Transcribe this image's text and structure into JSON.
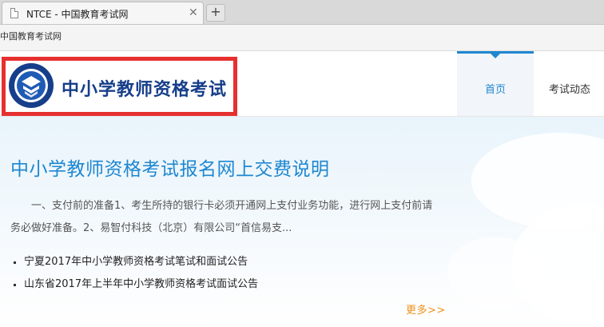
{
  "browser": {
    "tab_title": "NTCE - 中国教育考试网",
    "close_glyph": "✕",
    "new_tab_glyph": "+",
    "site_label": "中国教育考试网"
  },
  "header": {
    "logo_title": "中小学教师资格考试",
    "logo_highlight_color": "#e63030",
    "nav": [
      {
        "label": "首页",
        "active": true
      },
      {
        "label": "考试动态",
        "active": false
      }
    ],
    "accent_color": "#1e87d0"
  },
  "main": {
    "headline": "中小学教师资格考试报名网上交费说明",
    "summary": "一、支付前的准备1、考生所持的银行卡必须开通网上支付业务功能，进行网上支付前请务必做好准备。2、易智付科技（北京）有限公司“首信易支...",
    "news": [
      "宁夏2017年中小学教师资格考试笔试和面试公告",
      "山东省2017年上半年中小学教师资格考试面试公告"
    ],
    "more_label": "更多>>"
  }
}
